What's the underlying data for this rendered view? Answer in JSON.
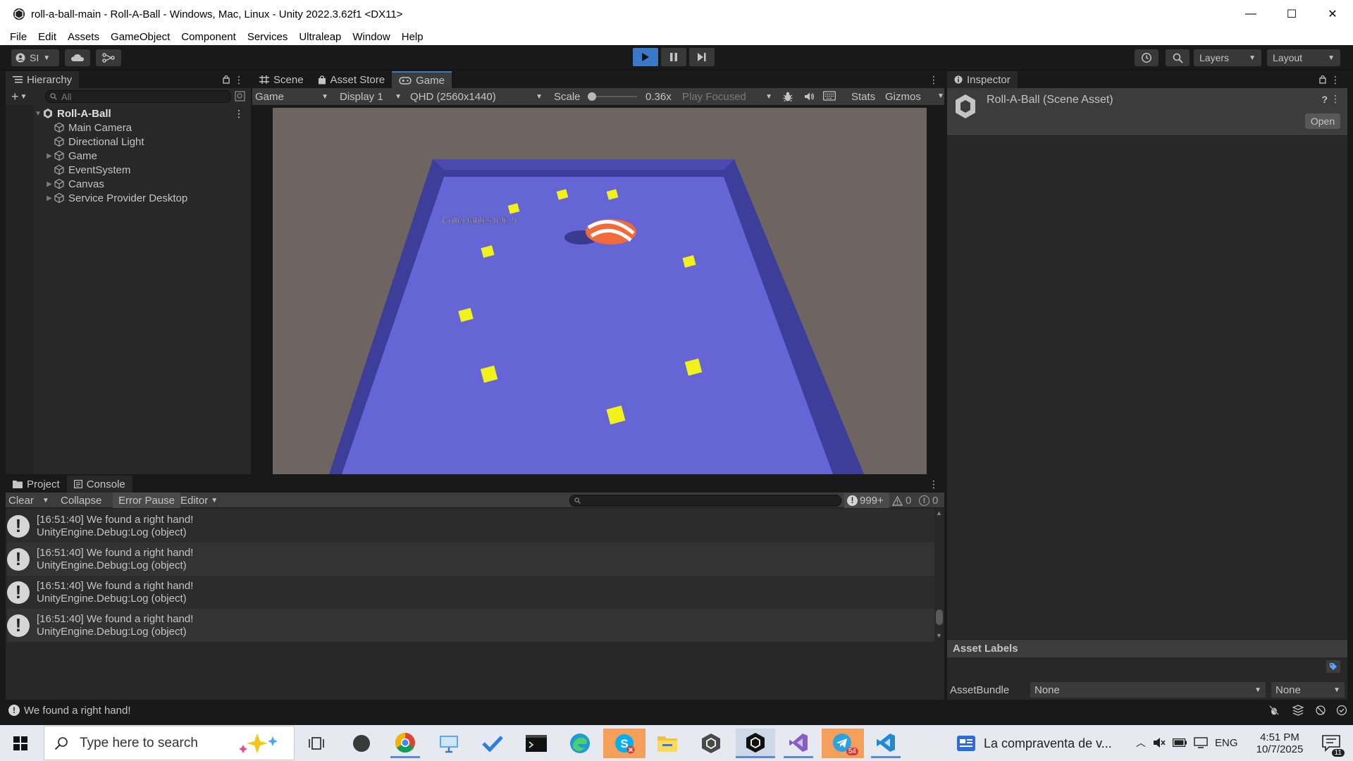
{
  "window": {
    "title": "roll-a-ball-main - Roll-A-Ball - Windows, Mac, Linux - Unity 2022.3.62f1 <DX11>",
    "minimize": "—",
    "maximize": "☐",
    "close": "✕"
  },
  "menu": [
    "File",
    "Edit",
    "Assets",
    "GameObject",
    "Component",
    "Services",
    "Ultraleap",
    "Window",
    "Help"
  ],
  "toolbar": {
    "account": "SI",
    "layers": "Layers",
    "layout": "Layout"
  },
  "hierarchy": {
    "tab": "Hierarchy",
    "search_placeholder": "All",
    "scene": "Roll-A-Ball",
    "items": [
      {
        "label": "Main Camera",
        "expandable": false
      },
      {
        "label": "Directional Light",
        "expandable": false
      },
      {
        "label": "Game",
        "expandable": true
      },
      {
        "label": "EventSystem",
        "expandable": false
      },
      {
        "label": "Canvas",
        "expandable": true
      },
      {
        "label": "Service Provider Desktop",
        "expandable": true
      }
    ]
  },
  "view_tabs": [
    "Scene",
    "Asset Store",
    "Game"
  ],
  "game_bar": {
    "mode": "Game",
    "display": "Display 1",
    "resolution": "QHD (2560x1440)",
    "scale_label": "Scale",
    "scale_value": "0.36x",
    "play_focused": "Play Focused",
    "stats": "Stats",
    "gizmos": "Gizmos"
  },
  "game_view": {
    "hud_text": "Collectables left: 9",
    "floor_color": "#6565d6",
    "wall_color": "#3d3d9a",
    "background_color": "#6e6461"
  },
  "inspector": {
    "tab": "Inspector",
    "asset_title": "Roll-A-Ball (Scene Asset)",
    "open_button": "Open",
    "asset_labels": "Asset Labels",
    "assetbundle_label": "AssetBundle",
    "assetbundle_value": "None",
    "variant_value": "None"
  },
  "bottom_tabs": [
    "Project",
    "Console"
  ],
  "console_toolbar": {
    "clear": "Clear",
    "collapse": "Collapse",
    "error_pause": "Error Pause",
    "editor": "Editor",
    "log_count": "999+",
    "warn_count": "0",
    "error_count": "0"
  },
  "console_rows": [
    {
      "line1": "[16:51:40] We found a right hand!",
      "line2": "UnityEngine.Debug:Log (object)"
    },
    {
      "line1": "[16:51:40] We found a right hand!",
      "line2": "UnityEngine.Debug:Log (object)"
    },
    {
      "line1": "[16:51:40] We found a right hand!",
      "line2": "UnityEngine.Debug:Log (object)"
    },
    {
      "line1": "[16:51:40] We found a right hand!",
      "line2": "UnityEngine.Debug:Log (object)"
    }
  ],
  "status_bar": {
    "message": "We found a right hand!"
  },
  "taskbar": {
    "search_placeholder": "Type here to search",
    "news": "La compraventa de v...",
    "language": "ENG",
    "time": "4:51 PM",
    "date": "10/7/2025",
    "notifications": "11",
    "telegram_badge": "54"
  }
}
